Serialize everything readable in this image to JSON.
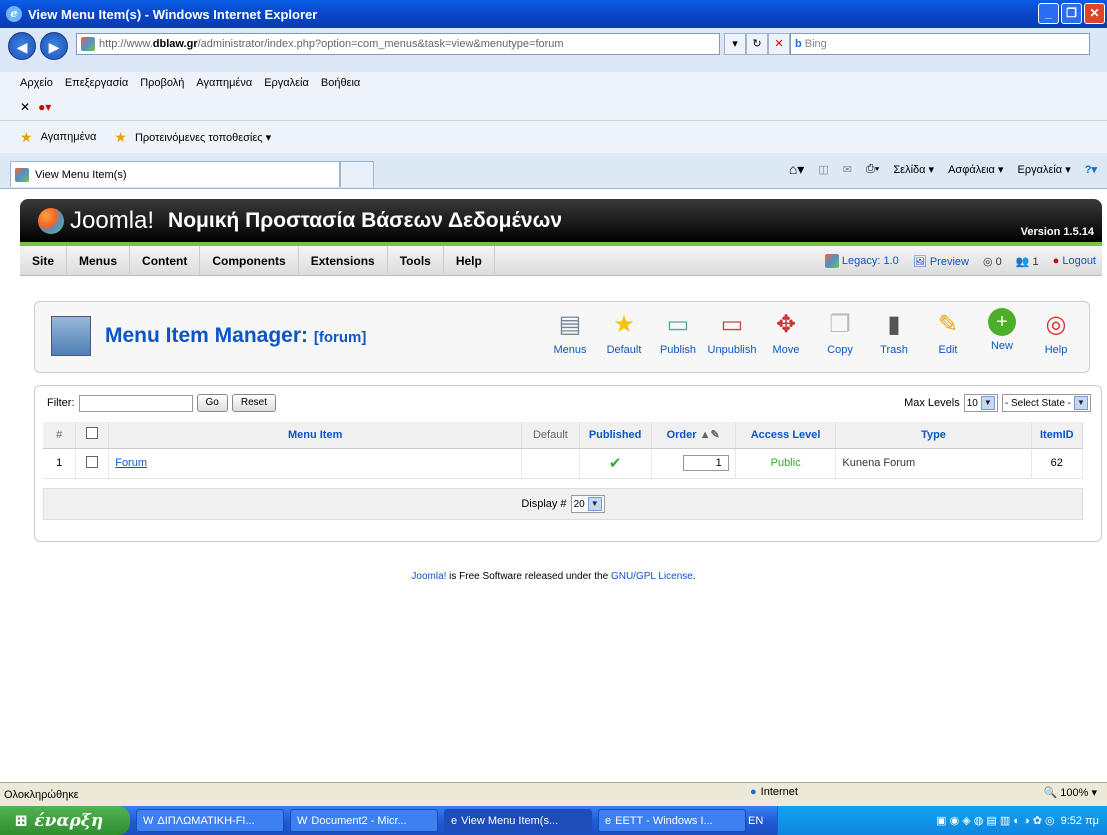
{
  "window": {
    "title": "View Menu Item(s) - Windows Internet Explorer"
  },
  "address": {
    "url_prefix": "http://www.",
    "url_domain": "dblaw.gr",
    "url_rest": "/administrator/index.php?option=com_menus&task=view&menutype=forum",
    "search_placeholder": "Bing"
  },
  "menubar": {
    "items": [
      "Αρχείο",
      "Επεξεργασία",
      "Προβολή",
      "Αγαπημένα",
      "Εργαλεία",
      "Βοήθεια"
    ]
  },
  "favorites": {
    "label": "Αγαπημένα",
    "suggested": "Προτεινόμενες τοποθεσίες ▾"
  },
  "tab": {
    "label": "View Menu Item(s)"
  },
  "ietools": {
    "page": "Σελίδα ▾",
    "safety": "Ασφάλεια ▾",
    "tools": "Εργαλεία ▾"
  },
  "joomla": {
    "logo_text": "Joomla!",
    "site_title": "Νομική Προστασία Βάσεων Δεδομένων",
    "version": "Version 1.5.14",
    "menu": [
      "Site",
      "Menus",
      "Content",
      "Components",
      "Extensions",
      "Tools",
      "Help"
    ],
    "status": {
      "legacy": "Legacy: 1.0",
      "preview": "Preview",
      "messages": "0",
      "users": "1",
      "logout": "Logout"
    },
    "page_title": "Menu Item Manager:",
    "page_subtitle": "[forum]",
    "toolbar": [
      "Menus",
      "Default",
      "Publish",
      "Unpublish",
      "Move",
      "Copy",
      "Trash",
      "Edit",
      "New",
      "Help"
    ],
    "filter": {
      "label": "Filter:",
      "go": "Go",
      "reset": "Reset",
      "max_levels": "Max Levels",
      "max_levels_value": "10",
      "state": "- Select State -"
    },
    "columns": [
      "#",
      "Menu Item",
      "Default",
      "Published",
      "Order",
      "Access Level",
      "Type",
      "ItemID"
    ],
    "rows": [
      {
        "num": "1",
        "name": "Forum",
        "published": "✔",
        "order": "1",
        "access": "Public",
        "type": "Kunena Forum",
        "itemid": "62"
      }
    ],
    "display": {
      "label": "Display #",
      "value": "20"
    },
    "legal_a": "Joomla!",
    "legal_b": " is Free Software released under the ",
    "legal_c": "GNU/GPL License",
    "legal_d": "."
  },
  "statusbar": {
    "text": "Ολοκληρώθηκε",
    "zone": "Internet",
    "zoom": "100%"
  },
  "taskbar": {
    "start": "έναρξη",
    "tasks": [
      "ΔΙΠΛΩΜΑΤΙΚΗ-FI...",
      "Document2 - Micr...",
      "View Menu Item(s...",
      "EETT - Windows I..."
    ],
    "lang": "EN",
    "time": "9:52 πμ"
  }
}
